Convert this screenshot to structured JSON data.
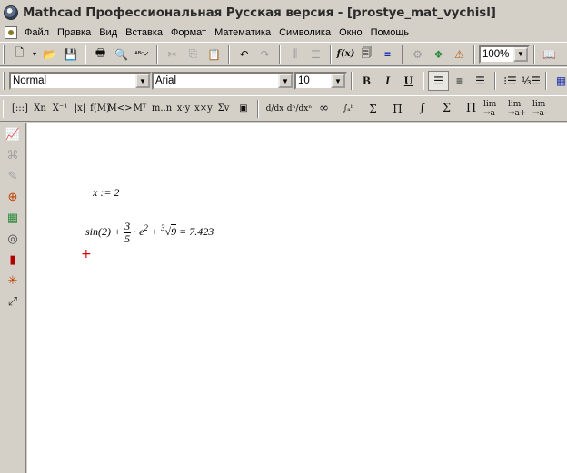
{
  "window": {
    "title": "Mathcad Профессиональная Русская версия - [prostye_mat_vychisl]"
  },
  "menu": [
    "Файл",
    "Правка",
    "Вид",
    "Вставка",
    "Формат",
    "Математика",
    "Символика",
    "Окно",
    "Помощь"
  ],
  "toolbar_standard": {
    "zoom_value": "100%",
    "buttons": [
      "new-document-icon",
      "open-folder-icon",
      "save-icon",
      "print-icon",
      "print-preview-icon",
      "spell-check-icon",
      "cut-icon",
      "copy-icon",
      "paste-icon",
      "undo-icon",
      "redo-icon",
      "align-horizontal-icon",
      "align-vertical-icon",
      "insert-function-icon",
      "insert-unit-icon",
      "calculate-icon",
      "insert-component-icon",
      "resource-center-icon",
      "quicksheets-icon",
      "help-icon"
    ]
  },
  "toolbar_formatting": {
    "style_value": "Normal",
    "font_value": "Arial",
    "size_value": "10",
    "bold_label": "B",
    "italic_label": "I",
    "underline_label": "U"
  },
  "toolbar_math_glyphs": {
    "matrix": "[:::]",
    "subscript": "Xn",
    "inverse": "X⁻¹",
    "absolute": "|x|",
    "vectorize": "f(M)",
    "superscript_matrix": "M<>",
    "transpose": "Mᵀ",
    "range": "m..n",
    "dot": "x·y",
    "cross": "x×y",
    "sum_vector": "Σv",
    "derivative": "d/dx",
    "nth_derivative": "dⁿ/dxⁿ",
    "infinity": "∞",
    "definite_integral": "∫ₐᵇ",
    "sum_range": "Σ",
    "product_range": "Π",
    "indefinite_integral": "∫",
    "sum": "Σ",
    "product": "Π",
    "limit": "lim →a",
    "limit_plus": "lim →a+",
    "limit_minus": "lim →a-"
  },
  "palette": [
    "graph-icon",
    "evaluation-icon",
    "calculus-icon",
    "boolean-icon",
    "programming-icon",
    "matrix-icon",
    "greek-icon",
    "symbolic-icon",
    "xy-plot-icon"
  ],
  "worksheet": {
    "definition": "x := 2",
    "expression_prefix": "sin(2) + ",
    "fraction_num": "3",
    "fraction_den": "5",
    "exp_part": "· e",
    "exp_power": "2",
    "plus": " + ",
    "root_index": "3",
    "root_radicand": "9",
    "result": "= 7.423",
    "cursor_symbol": "+"
  },
  "colors": {
    "background": "#d4d0c8",
    "worksheet": "#ffffff",
    "cursor": "#d00000"
  }
}
